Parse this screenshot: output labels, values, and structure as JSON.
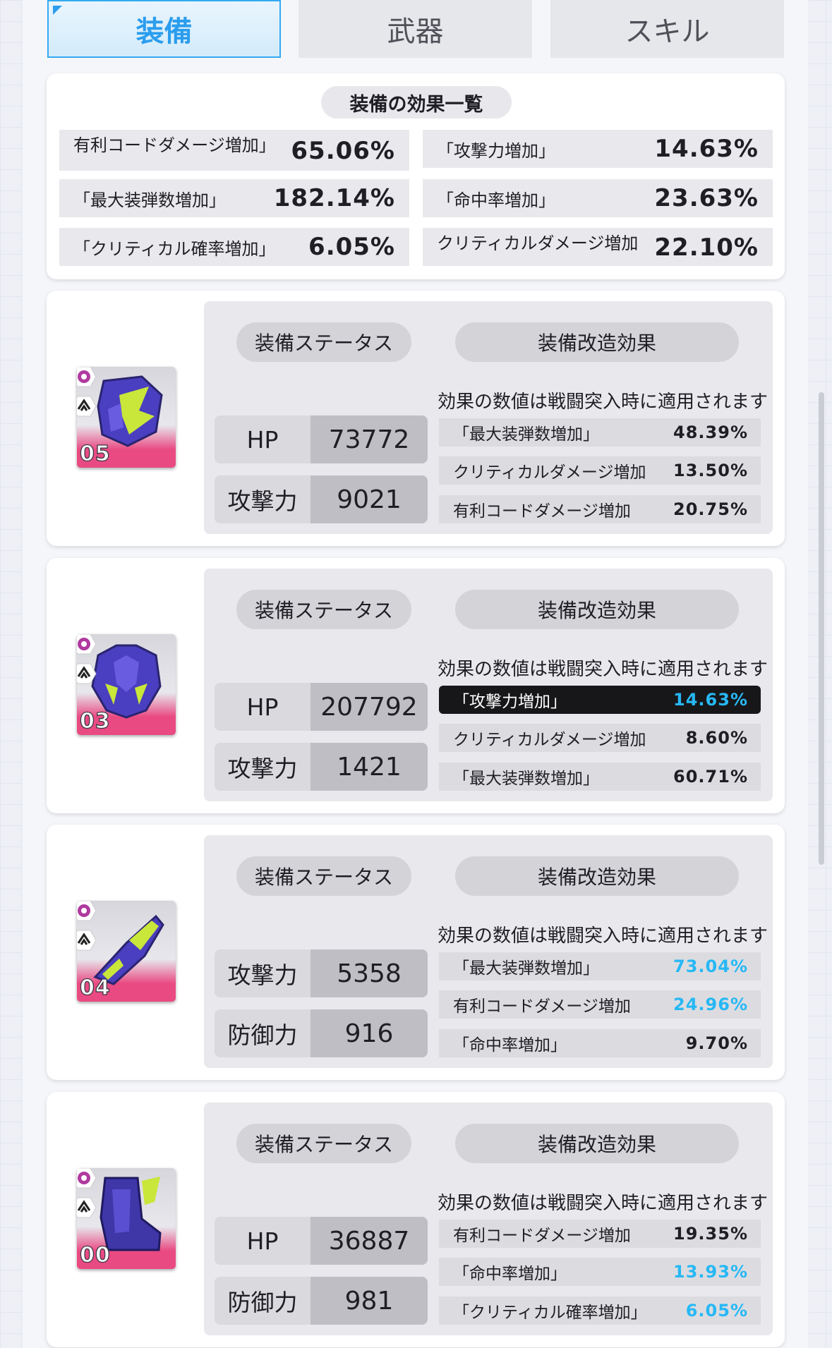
{
  "tabs": [
    {
      "label": "装備",
      "active": true
    },
    {
      "label": "武器",
      "active": false
    },
    {
      "label": "スキル",
      "active": false
    }
  ],
  "summary": {
    "title": "装備の効果一覧",
    "items": [
      {
        "label": "有利コードダメージ増加」",
        "value": "65.06%"
      },
      {
        "label": "「攻撃力増加」",
        "value": "14.63%"
      },
      {
        "label": "「最大装弾数増加」",
        "value": "182.14%"
      },
      {
        "label": "「命中率増加」",
        "value": "23.63%"
      },
      {
        "label": "「クリティカル確率増加」",
        "value": "6.05%"
      },
      {
        "label": "クリティカルダメージ増加",
        "value": "22.10%"
      }
    ]
  },
  "colors": {
    "accent": "#2b9ded",
    "highlight_value": "#27b8f5",
    "level_bar": "#e94a82"
  },
  "equipment": [
    {
      "level": "05",
      "icon": "helmet-armor-icon",
      "status_label": "装備ステータス",
      "mod_label": "装備改造効果",
      "note": "効果の数値は戦闘突入時に適用されます",
      "stats": [
        {
          "name": "HP",
          "value": "73772"
        },
        {
          "name": "攻撃力",
          "value": "9021"
        }
      ],
      "mods": [
        {
          "label": "「最大装弾数増加」",
          "value": "48.39%",
          "style": "normal"
        },
        {
          "label": "クリティカルダメージ増加",
          "value": "13.50%",
          "style": "normal"
        },
        {
          "label": "有利コードダメージ増加",
          "value": "20.75%",
          "style": "normal"
        }
      ]
    },
    {
      "level": "03",
      "icon": "chest-armor-icon",
      "status_label": "装備ステータス",
      "mod_label": "装備改造効果",
      "note": "効果の数値は戦闘突入時に適用されます",
      "stats": [
        {
          "name": "HP",
          "value": "207792"
        },
        {
          "name": "攻撃力",
          "value": "1421"
        }
      ],
      "mods": [
        {
          "label": "「攻撃力増加」",
          "value": "14.63%",
          "style": "highlight"
        },
        {
          "label": "クリティカルダメージ増加",
          "value": "8.60%",
          "style": "normal"
        },
        {
          "label": "「最大装弾数増加」",
          "value": "60.71%",
          "style": "normal"
        }
      ]
    },
    {
      "level": "04",
      "icon": "arm-armor-icon",
      "status_label": "装備ステータス",
      "mod_label": "装備改造効果",
      "note": "効果の数値は戦闘突入時に適用されます",
      "stats": [
        {
          "name": "攻撃力",
          "value": "5358"
        },
        {
          "name": "防御力",
          "value": "916"
        }
      ],
      "mods": [
        {
          "label": "「最大装弾数増加」",
          "value": "73.04%",
          "style": "blue"
        },
        {
          "label": "有利コードダメージ増加",
          "value": "24.96%",
          "style": "blue"
        },
        {
          "label": "「命中率増加」",
          "value": "9.70%",
          "style": "normal"
        }
      ]
    },
    {
      "level": "00",
      "icon": "leg-armor-icon",
      "status_label": "装備ステータス",
      "mod_label": "装備改造効果",
      "note": "効果の数値は戦闘突入時に適用されます",
      "stats": [
        {
          "name": "HP",
          "value": "36887"
        },
        {
          "name": "防御力",
          "value": "981"
        }
      ],
      "mods": [
        {
          "label": "有利コードダメージ増加",
          "value": "19.35%",
          "style": "normal"
        },
        {
          "label": "「命中率増加」",
          "value": "13.93%",
          "style": "blue"
        },
        {
          "label": "「クリティカル確率増加」",
          "value": "6.05%",
          "style": "blue"
        }
      ]
    }
  ]
}
